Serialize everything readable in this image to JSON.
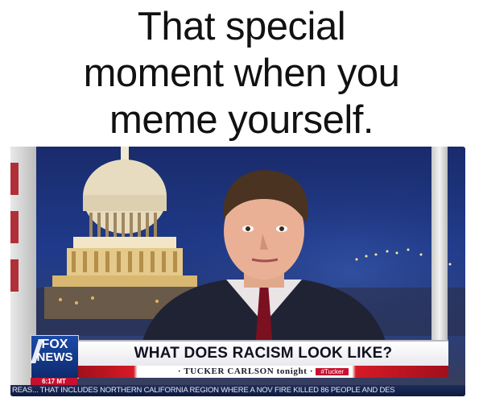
{
  "caption": {
    "line1": "That special",
    "line2": "moment when you",
    "line3": "meme yourself."
  },
  "broadcast": {
    "logo_line1": "FOX",
    "logo_line2": "NEWS",
    "clock": "6:17 MT",
    "headline": "WHAT DOES RACISM LOOK LIKE?",
    "show_name": "· TUCKER CARLSON tonight ·",
    "show_tag": "#Tucker",
    "ticker": "REAS... THAT INCLUDES NORTHERN CALIFORNIA REGION WHERE A NOV FIRE KILLED 86 PEOPLE AND DES"
  },
  "colors": {
    "fox_blue": "#1b4aa8",
    "fox_red": "#c8102e",
    "ticker_navy": "#0f1a3d"
  }
}
